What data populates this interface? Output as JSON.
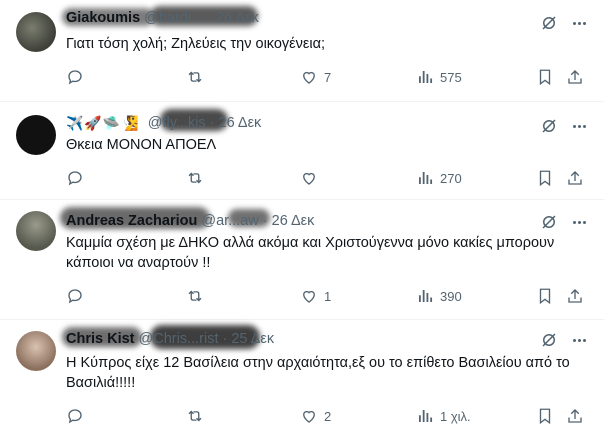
{
  "tweets": [
    {
      "name": "Giakoumis",
      "handle": "@hardi...",
      "emojis": "",
      "sep": "·",
      "date": "26 Δεκ",
      "text": "Γιατι τόση χολή; Ζηλεύεις την οικογένεια;",
      "reply_count": "",
      "retweet_count": "",
      "like_count": "7",
      "views": "575"
    },
    {
      "name": "",
      "handle": "@fly...kis",
      "emojis": "✈️🚀🛸🧏",
      "sep": "·",
      "date": "26 Δεκ",
      "text": "Θκεια ΜΟΝΟΝ ΑΠΟΕΛ",
      "reply_count": "",
      "retweet_count": "",
      "like_count": "",
      "views": "270"
    },
    {
      "name": "Andreas Zachariou",
      "handle": "@ar...aw",
      "emojis": "",
      "sep": "·",
      "date": "26 Δεκ",
      "text": "Καμμία σχέση με ΔΗΚΟ αλλά ακόμα και Χριστούγεννα μόνο κακίες μπορουν κάποιοι να αναρτούν !!",
      "reply_count": "",
      "retweet_count": "",
      "like_count": "1",
      "views": "390"
    },
    {
      "name": "Chris Kist",
      "handle": "@Chris...rist",
      "emojis": "",
      "sep": "·",
      "date": "25 Δεκ",
      "text": "Η Κύπρος είχε 12 Βασίλεια στην αρχαιότητα,εξ ου το επίθετο Βασιλείου από το Βασιλιά!!!!!",
      "reply_count": "",
      "retweet_count": "",
      "like_count": "2",
      "views": "1 χιλ."
    }
  ],
  "icons": [
    "reply-icon",
    "retweet-icon",
    "like-icon",
    "views-icon",
    "bookmark-icon",
    "share-icon",
    "grok-icon",
    "more-icon"
  ],
  "colors": {
    "text": "#0f1419",
    "muted": "#536471",
    "divider": "#eff3f4"
  }
}
